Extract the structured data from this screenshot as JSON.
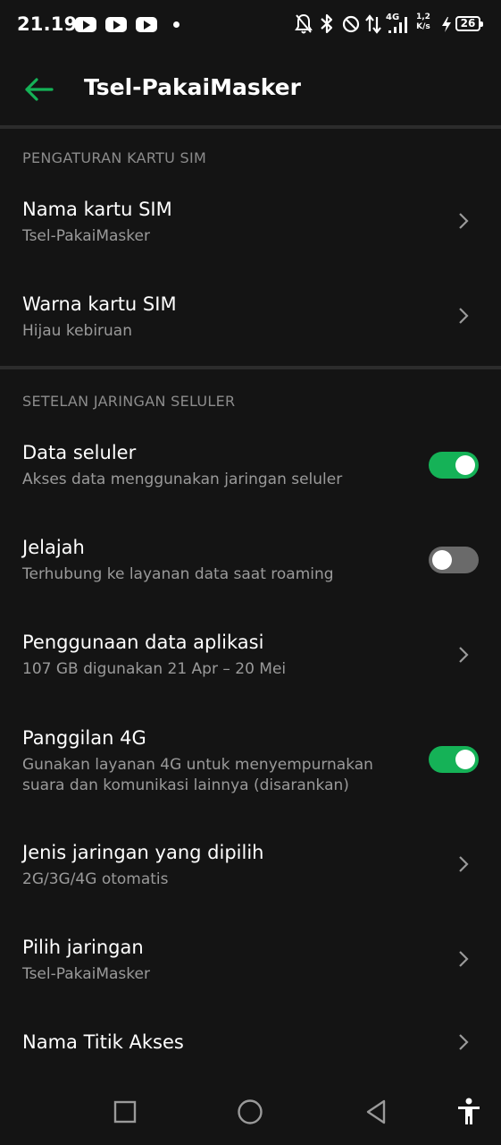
{
  "status": {
    "time": "21.19",
    "network_type": "4G",
    "speed_value": "1,2",
    "speed_unit": "K/s",
    "battery": "26",
    "icons": [
      "youtube-icon",
      "youtube-icon",
      "youtube-icon",
      "notification-dot",
      "bell-off-icon",
      "bluetooth-icon",
      "dnd-icon",
      "data-arrows-icon",
      "signal-icon",
      "charging-icon",
      "battery-icon"
    ]
  },
  "appbar": {
    "title": "Tsel-PakaiMasker",
    "back_icon": "arrow-left-icon"
  },
  "colors": {
    "accent": "#15b257",
    "background": "#141414",
    "toggle_off": "#6a6a6a"
  },
  "sim_settings": {
    "header": "PENGATURAN KARTU SIM",
    "items": [
      {
        "title": "Nama kartu SIM",
        "subtitle": "Tsel-PakaiMasker"
      },
      {
        "title": "Warna kartu SIM",
        "subtitle": "Hijau kebiruan"
      }
    ]
  },
  "network_settings": {
    "header": "SETELAN JARINGAN SELULER",
    "items": [
      {
        "title": "Data seluler",
        "subtitle": "Akses data menggunakan jaringan seluler",
        "toggle": true
      },
      {
        "title": "Jelajah",
        "subtitle": "Terhubung ke layanan data saat roaming",
        "toggle": false
      },
      {
        "title": "Penggunaan data aplikasi",
        "subtitle": "107 GB digunakan 21 Apr – 20 Mei"
      },
      {
        "title": "Panggilan 4G",
        "subtitle": "Gunakan layanan 4G untuk menyempurnakan suara dan komunikasi lainnya (disarankan)",
        "toggle": true
      },
      {
        "title": "Jenis jaringan yang dipilih",
        "subtitle": "2G/3G/4G otomatis"
      },
      {
        "title": "Pilih jaringan",
        "subtitle": "Tsel-PakaiMasker"
      },
      {
        "title": "Nama Titik Akses",
        "subtitle": ""
      }
    ]
  },
  "navbar": {
    "icons": [
      "recents-square-icon",
      "home-circle-icon",
      "back-triangle-icon",
      "accessibility-icon"
    ]
  }
}
